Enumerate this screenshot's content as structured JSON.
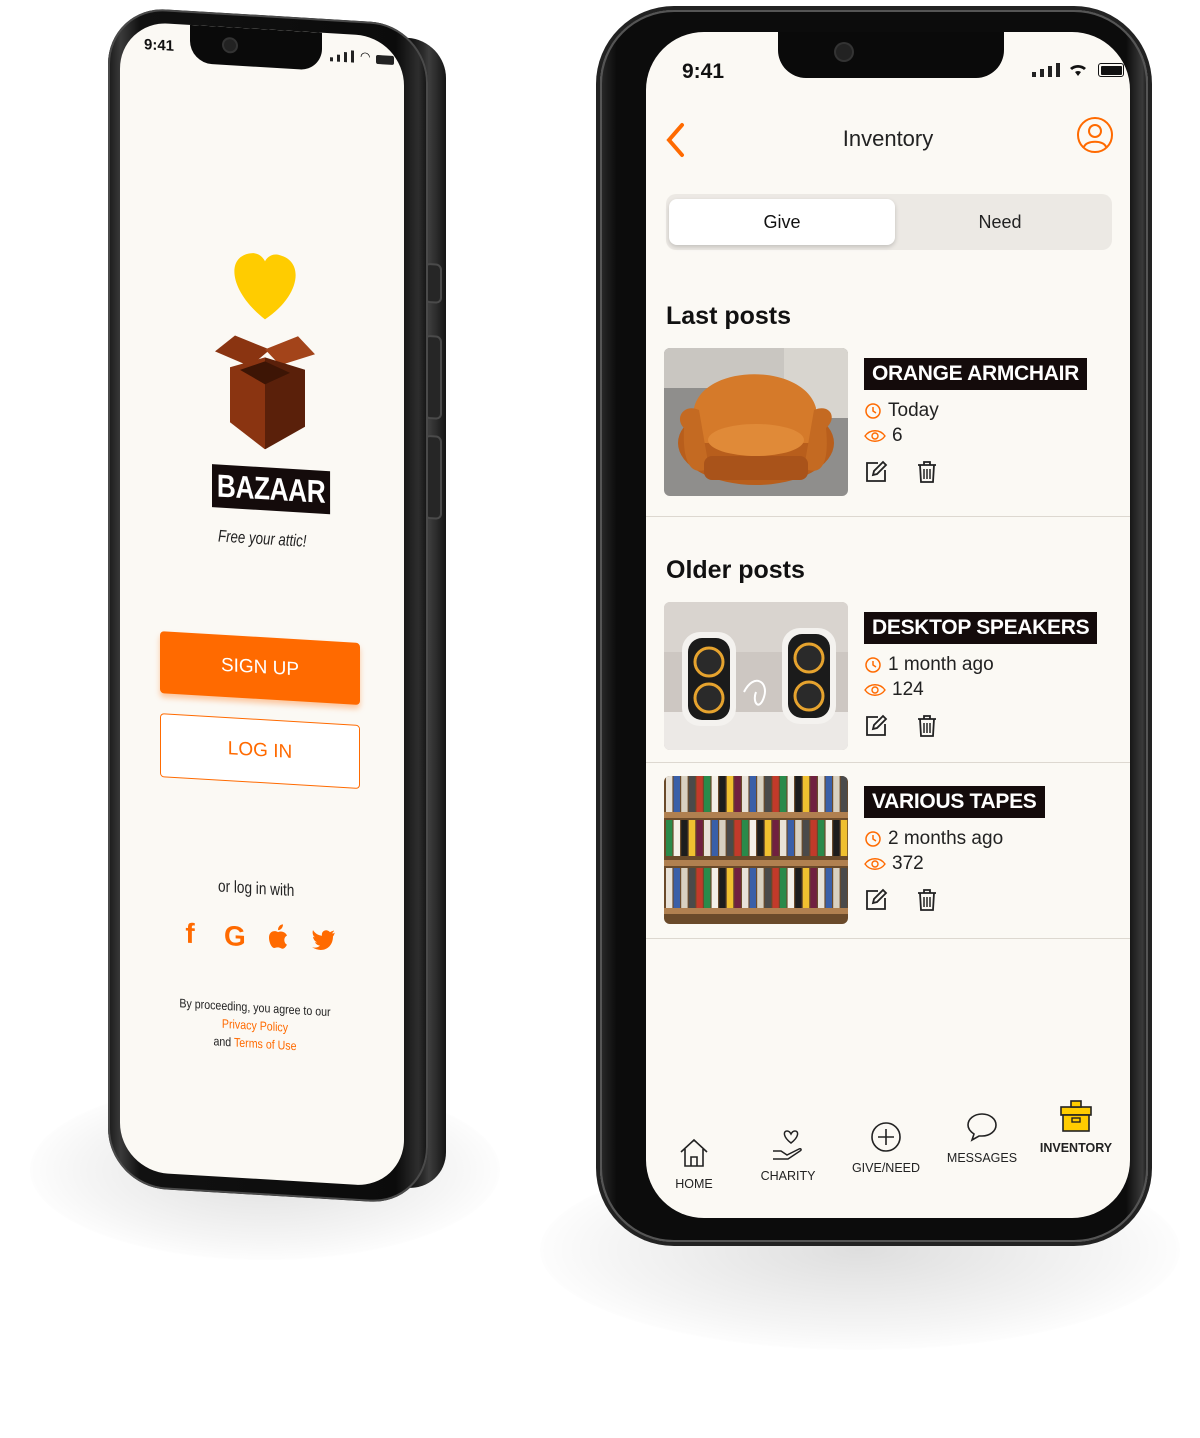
{
  "left_phone": {
    "status_time": "9:41",
    "brand_name": "BAZAAR",
    "tagline": "Free your attic!",
    "signup_label": "SIGN UP",
    "login_label": "LOG IN",
    "or_login_with": "or log in with",
    "social_icons": [
      "facebook-icon",
      "google-icon",
      "apple-icon",
      "twitter-icon"
    ],
    "social_glyphs": [
      "f",
      "G",
      "",
      ""
    ],
    "legal_prefix": "By proceeding, you agree to our",
    "privacy_link": "Privacy Policy",
    "legal_and": "and",
    "terms_link": "Terms of Use"
  },
  "right_phone": {
    "status_time": "9:41",
    "title": "Inventory",
    "segments": {
      "give": "Give",
      "need": "Need",
      "selected": "Give"
    },
    "last_posts_heading": "Last posts",
    "older_posts_heading": "Older posts",
    "last_posts": [
      {
        "title": "ORANGE ARMCHAIR",
        "time": "Today",
        "views": "6"
      }
    ],
    "older_posts": [
      {
        "title": "DESKTOP SPEAKERS",
        "time": "1 month ago",
        "views": "124"
      },
      {
        "title": "VARIOUS TAPES",
        "time": "2 months ago",
        "views": "372"
      }
    ],
    "tabs": [
      {
        "label": "HOME",
        "icon": "home-icon"
      },
      {
        "label": "CHARITY",
        "icon": "charity-icon"
      },
      {
        "label": "GIVE/NEED",
        "icon": "plus-circle-icon"
      },
      {
        "label": "MESSAGES",
        "icon": "chat-bubble-icon"
      },
      {
        "label": "INVENTORY",
        "icon": "box-icon",
        "active": true
      }
    ]
  },
  "colors": {
    "accent": "#ff6a00",
    "dark": "#140b0b",
    "background": "#fbf9f4",
    "box_yellow": "#ffcc00"
  }
}
